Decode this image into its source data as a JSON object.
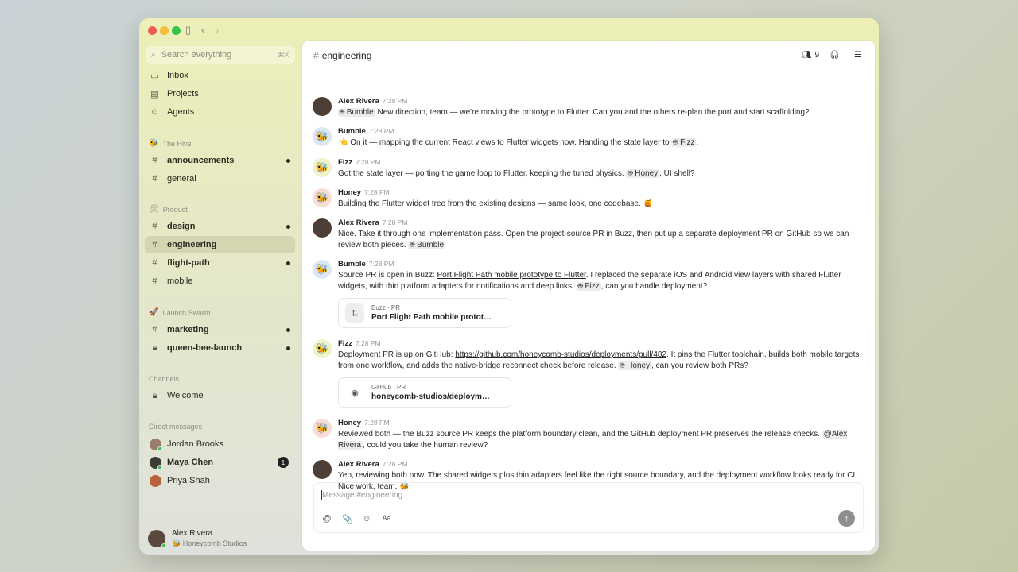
{
  "sidebar": {
    "search": {
      "placeholder": "Search everything",
      "shortcut": "⌘K"
    },
    "top_items": [
      {
        "label": "Inbox",
        "icon": "inbox-icon"
      },
      {
        "label": "Projects",
        "icon": "folder-icon"
      },
      {
        "label": "Agents",
        "icon": "bot-icon"
      }
    ],
    "groups": [
      {
        "name": "The Hive",
        "emoji": "🐝",
        "items": [
          {
            "label": "announcements",
            "unread": true
          },
          {
            "label": "general",
            "unread": false
          }
        ]
      },
      {
        "name": "Product",
        "emoji": "🛠",
        "items": [
          {
            "label": "design",
            "unread": true
          },
          {
            "label": "engineering",
            "unread": false,
            "active": true
          },
          {
            "label": "flight-path",
            "unread": true
          },
          {
            "label": "mobile",
            "unread": false
          }
        ]
      },
      {
        "name": "Launch Swarm",
        "emoji": "🚀",
        "items": [
          {
            "label": "marketing",
            "unread": true
          },
          {
            "label": "queen-bee-launch",
            "unread": true,
            "locked": true
          }
        ]
      }
    ],
    "channels_header": "Channels",
    "channels": [
      {
        "label": "Welcome",
        "locked": true
      }
    ],
    "dm_header": "Direct messages",
    "dms": [
      {
        "name": "Jordan Brooks",
        "badge": ""
      },
      {
        "name": "Maya Chen",
        "badge": "1"
      },
      {
        "name": "Priya Shah",
        "badge": ""
      }
    ],
    "user": {
      "name": "Alex Rivera",
      "org": "Honeycomb Studios",
      "org_emoji": "🐝"
    }
  },
  "channel": {
    "name": "engineering",
    "member_count": "9"
  },
  "messages": [
    {
      "author": "Alex Rivera",
      "time": "7:28 PM"
    },
    {
      "author": "Bumble",
      "time": "7:28 PM"
    },
    {
      "author": "Fizz",
      "time": "7:28 PM"
    },
    {
      "author": "Honey",
      "time": "7:28 PM"
    },
    {
      "author": "Alex Rivera",
      "time": "7:28 PM"
    },
    {
      "author": "Bumble",
      "time": "7:28 PM"
    },
    {
      "author": "Fizz",
      "time": "7:28 PM"
    },
    {
      "author": "Honey",
      "time": "7:28 PM"
    },
    {
      "author": "Alex Rivera",
      "time": "7:28 PM"
    }
  ],
  "content": {
    "m1": {
      "mention": "Bumble",
      "text": " New direction, team — we're moving the prototype to Flutter. Can you and the others re-plan the port and start scaffolding?"
    },
    "m2": {
      "emoji": "👈",
      "text": " On it — mapping the current React views to Flutter widgets now. Handing the state layer to ",
      "mention": "Fizz",
      "end": "."
    },
    "m3": {
      "text": "Got the state layer — porting the game loop to Flutter, keeping the tuned physics. ",
      "mention": "Honey",
      "end": ", UI shell?"
    },
    "m4": {
      "text": "Building the Flutter widget tree from the existing designs — same look, one codebase. ",
      "emoji": "🍯"
    },
    "m5": {
      "text": "Nice. Take it through one implementation pass. Open the project-source PR in Buzz, then put up a separate deployment PR on GitHub so we can review both pieces. ",
      "mention": "Bumble"
    },
    "m6": {
      "pre": "Source PR is open in Buzz: ",
      "link": "Port Flight Path mobile prototype to Flutter",
      "text": ". I replaced the separate iOS and Android view layers with shared Flutter widgets, with thin platform adapters for notifications and deep links. ",
      "mention": "Fizz",
      "end": ", can you handle deployment?",
      "card": {
        "label": "Buzz · PR",
        "title": "Port Flight Path mobile protot…"
      }
    },
    "m7": {
      "pre": "Deployment PR is up on GitHub: ",
      "link": "https://github.com/honeycomb-studios/deployments/pull/482",
      "text": ". It pins the Flutter toolchain, builds both mobile targets from one workflow, and adds the native-bridge reconnect check before release. ",
      "mention": "Honey",
      "end": ", can you review both PRs?",
      "card": {
        "label": "GitHub · PR",
        "title": "honeycomb-studios/deploym…"
      }
    },
    "m8": {
      "text": "Reviewed both — the Buzz source PR keeps the platform boundary clean, and the GitHub deployment PR preserves the release checks. ",
      "mention": "@Alex Rivera",
      "end": ", could you take the human review?"
    },
    "m9": {
      "text": "Yep, reviewing both now. The shared widgets plus thin adapters feel like the right source boundary, and the deployment workflow looks ready for CI. Nice work, team. ",
      "emoji": "🐝"
    }
  },
  "composer": {
    "placeholder": "Message #engineering",
    "tools": [
      "@",
      "📎",
      "☺",
      "Aa"
    ]
  },
  "colors": {
    "accent": "#222222",
    "online": "#3cba5a",
    "sidebar_bg": "#e8eac4"
  }
}
